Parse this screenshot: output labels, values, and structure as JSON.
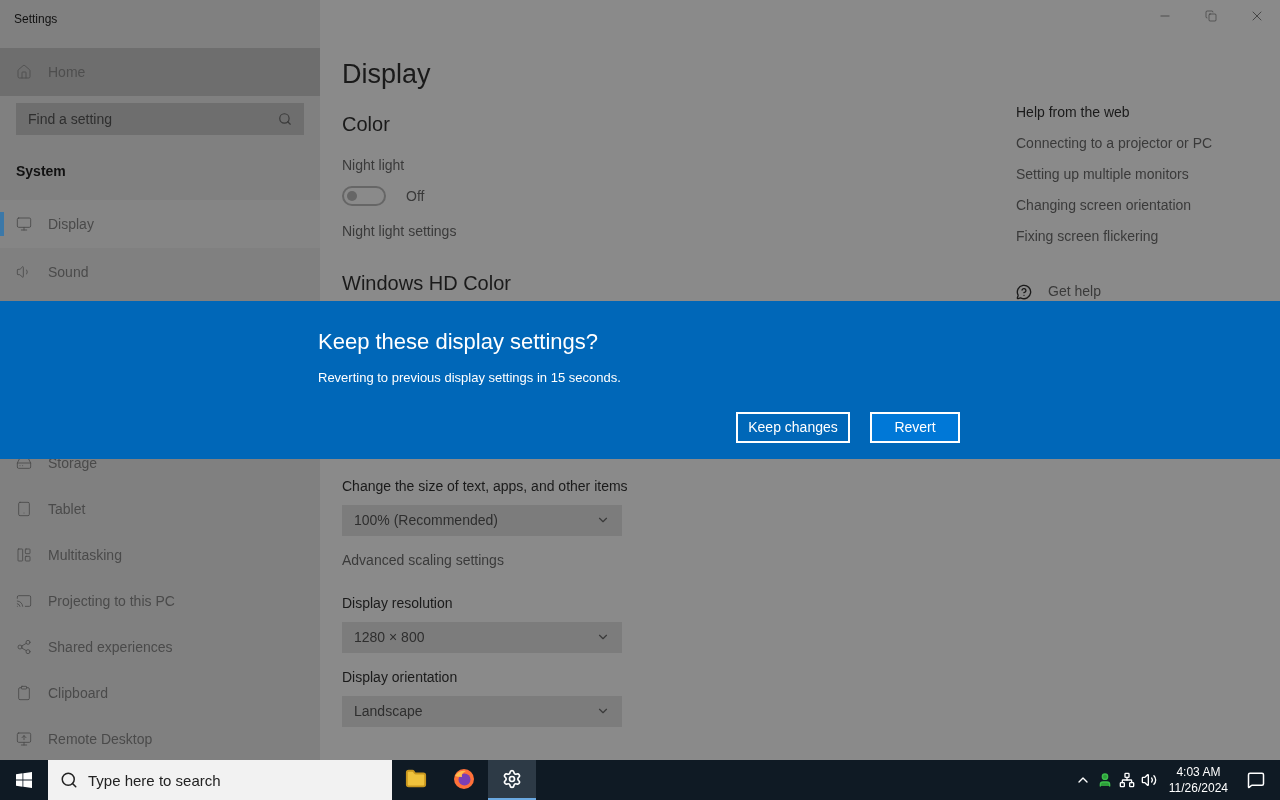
{
  "window": {
    "title": "Settings"
  },
  "sidebar": {
    "home": "Home",
    "search": {
      "placeholder": "Find a setting"
    },
    "section": "System",
    "groups": [
      [
        {
          "label": "Display",
          "selected": true
        },
        {
          "label": "Sound",
          "selected": false
        }
      ],
      [
        {
          "label": "Storage",
          "selected": false
        },
        {
          "label": "Tablet",
          "selected": false
        },
        {
          "label": "Multitasking",
          "selected": false
        },
        {
          "label": "Projecting to this PC",
          "selected": false
        },
        {
          "label": "Shared experiences",
          "selected": false
        },
        {
          "label": "Clipboard",
          "selected": false
        },
        {
          "label": "Remote Desktop",
          "selected": false
        }
      ]
    ]
  },
  "content": {
    "title": "Display",
    "color_heading": "Color",
    "night_light": {
      "label": "Night light",
      "on": false,
      "state_text": "Off"
    },
    "night_light_link": "Night light settings",
    "hd_color_heading": "Windows HD Color",
    "scale_label": "Change the size of text, apps, and other items",
    "scale_value": "100% (Recommended)",
    "advanced_link": "Advanced scaling settings",
    "resolution_label": "Display resolution",
    "resolution_value": "1280 × 800",
    "orientation_label": "Display orientation",
    "orientation_value": "Landscape"
  },
  "help": {
    "title": "Help from the web",
    "links": [
      "Connecting to a projector or PC",
      "Setting up multiple monitors",
      "Changing screen orientation",
      "Fixing screen flickering"
    ],
    "get_help": "Get help"
  },
  "dialog": {
    "title": "Keep these display settings?",
    "message": "Reverting to previous display settings in 15 seconds.",
    "buttons": [
      "Keep changes",
      "Revert"
    ]
  },
  "taskbar": {
    "search_placeholder": "Type here to search",
    "apps": [
      {
        "kind": "explorer",
        "selected": false
      },
      {
        "kind": "firefox",
        "selected": false
      },
      {
        "kind": "settings",
        "selected": true
      }
    ],
    "time": "4:03 AM",
    "date": "11/26/2024"
  }
}
